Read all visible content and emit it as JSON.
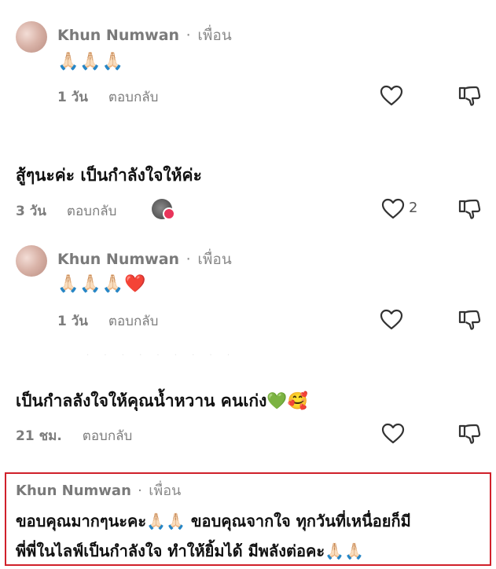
{
  "comments": [
    {
      "author": "Khun Numwan",
      "separator": "·",
      "relation": "เพื่อน",
      "text": "🙏🏻🙏🏻🙏🏻",
      "time": "1 วัน",
      "reply_label": "ตอบกลับ"
    },
    {
      "text": "สู้ๆนะค่ะ เป็นกำลังใจให้ค่ะ",
      "time": "3 วัน",
      "reply_label": "ตอบกลับ",
      "like_count": "2"
    },
    {
      "author": "Khun Numwan",
      "separator": "·",
      "relation": "เพื่อน",
      "text": "🙏🏻🙏🏻🙏🏻❤️",
      "time": "1 วัน",
      "reply_label": "ตอบกลับ"
    },
    {
      "text": "เป็นกำลลังใจให้คุณน้ำหวาน คนเก่ง💚🥰",
      "time": "21 ชม.",
      "reply_label": "ตอบกลับ"
    }
  ],
  "highlighted": {
    "author": "Khun Numwan",
    "separator": "·",
    "relation": "เพื่อน",
    "line1": "ขอบคุณมากๆนะคะ🙏🏻🙏🏻 ขอบคุณจากใจ ทุกวันที่เหนื่อยก็มี",
    "line2": "พี่พี่ในไลฟ์เป็นกำลังใจ ทำให้ยิ้มได้ มีพลังต่อคะ🙏🏻🙏🏻",
    "border_color": "#d0202a"
  },
  "icons": {
    "like": "heart-outline-icon",
    "dislike": "thumbs-down-outline-icon"
  }
}
